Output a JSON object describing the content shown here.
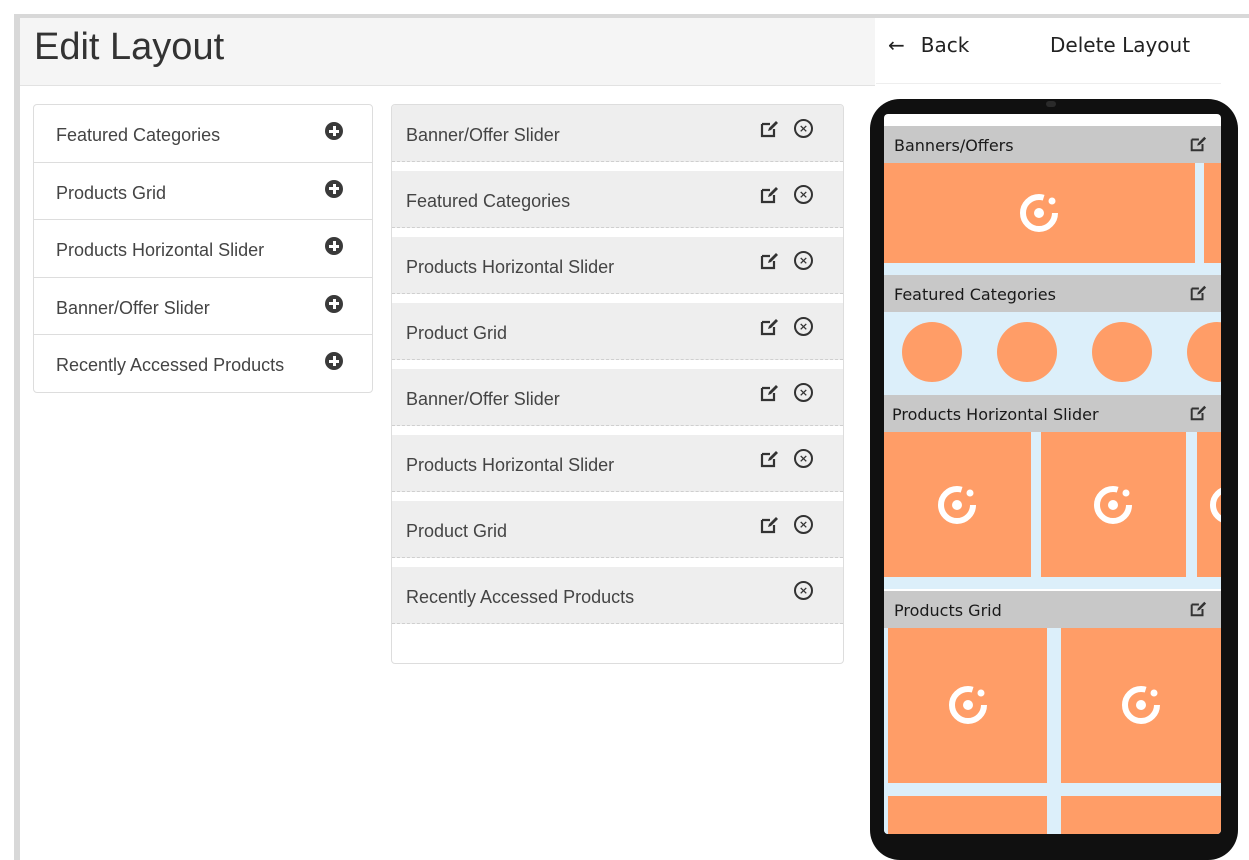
{
  "header": {
    "title": "Edit Layout",
    "back_label": "Back",
    "back_arrow": "←",
    "delete_label": "Delete Layout"
  },
  "widgets": [
    {
      "label": "Featured Categories",
      "icon": "plus-circle-icon"
    },
    {
      "label": "Products Grid",
      "icon": "plus-circle-icon"
    },
    {
      "label": "Products Horizontal Slider",
      "icon": "plus-circle-icon"
    },
    {
      "label": "Banner/Offer Slider",
      "icon": "plus-circle-icon"
    },
    {
      "label": "Recently Accessed Products",
      "icon": "plus-circle-icon"
    }
  ],
  "layout": [
    {
      "label": "Banner/Offer Slider",
      "editable": true
    },
    {
      "label": "Featured Categories",
      "editable": true
    },
    {
      "label": "Products Horizontal Slider",
      "editable": true
    },
    {
      "label": "Product Grid",
      "editable": true
    },
    {
      "label": "Banner/Offer Slider",
      "editable": true
    },
    {
      "label": "Products Horizontal Slider",
      "editable": true
    },
    {
      "label": "Product Grid",
      "editable": true
    },
    {
      "label": "Recently Accessed Products",
      "editable": false
    }
  ],
  "preview": {
    "sections": [
      {
        "title": "Banners/Offers"
      },
      {
        "title": "Featured Categories"
      },
      {
        "title": "Products Horizontal Slider"
      },
      {
        "title": "Products Grid"
      }
    ]
  },
  "colors": {
    "tile": "#ff9d67",
    "section_bg": "#dceffa",
    "section_header": "#c8c8c8"
  }
}
